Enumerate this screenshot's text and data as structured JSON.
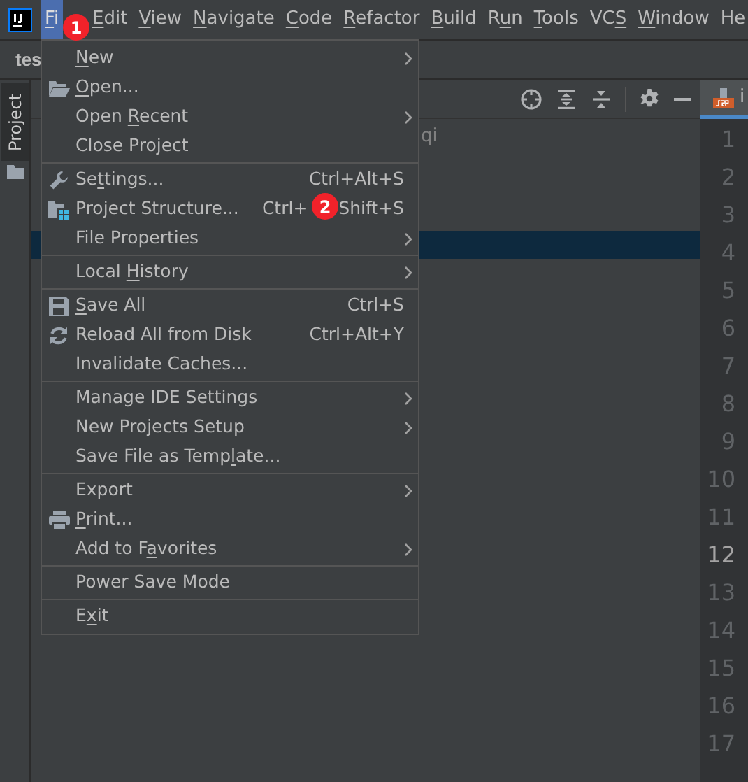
{
  "menu_bar": [
    {
      "mnemonic": "F",
      "label_end": "i",
      "selected": true
    },
    {
      "mnemonic": "E",
      "label_end": "dit",
      "selected": false
    },
    {
      "mnemonic": "V",
      "label_end": "iew",
      "selected": false
    },
    {
      "mnemonic": "N",
      "label_end": "avigate",
      "selected": false
    },
    {
      "mnemonic": "C",
      "label_end": "ode",
      "selected": false
    },
    {
      "mnemonic": "R",
      "label_end": "efactor",
      "selected": false
    },
    {
      "mnemonic": "B",
      "label_end": "uild",
      "selected": false
    },
    {
      "label_start": "R",
      "mnemonic": "u",
      "label_end": "n",
      "selected": false
    },
    {
      "mnemonic": "T",
      "label_end": "ools",
      "selected": false
    },
    {
      "label_start": "VC",
      "mnemonic": "S",
      "selected": false
    },
    {
      "mnemonic": "W",
      "label_end": "indow",
      "selected": false
    },
    {
      "label_start": "He",
      "selected": false
    }
  ],
  "project_title": "tes",
  "tool_window_stripe": {
    "label": "Project",
    "selected": true
  },
  "project_tree": {
    "text_fragment": "qi",
    "selected_row": true
  },
  "editor": {
    "tab_label": "i",
    "line_numbers": [
      {
        "label": "1",
        "current": false
      },
      {
        "label": "2",
        "current": false
      },
      {
        "label": "3",
        "current": false
      },
      {
        "label": "4",
        "current": false
      },
      {
        "label": "5",
        "current": false
      },
      {
        "label": "6",
        "current": false
      },
      {
        "label": "7",
        "current": false
      },
      {
        "label": "8",
        "current": false
      },
      {
        "label": "9",
        "current": false
      },
      {
        "label": "10",
        "current": false
      },
      {
        "label": "11",
        "current": false
      },
      {
        "label": "12",
        "current": true
      },
      {
        "label": "13",
        "current": false
      },
      {
        "label": "14",
        "current": false
      },
      {
        "label": "15",
        "current": false
      },
      {
        "label": "16",
        "current": false
      },
      {
        "label": "17",
        "current": false
      }
    ]
  },
  "file_menu": {
    "groups": [
      {
        "items": [
          {
            "mnemonic": "N",
            "label_end": "ew",
            "submenu": true
          },
          {
            "mnemonic": "O",
            "label_end": "pen...",
            "submenu": false
          },
          {
            "label_start": "Open ",
            "mnemonic": "R",
            "label_end": "ecent",
            "submenu": true
          },
          {
            "label_start": "Close Project",
            "submenu": false
          }
        ]
      },
      {
        "items": [
          {
            "label_start": "Se",
            "mnemonic": "t",
            "label_end": "tings...",
            "shortcut": [
              "Ctrl+Alt+S"
            ],
            "submenu": false
          },
          {
            "label_start": "Project Structure...",
            "shortcut": [
              "Ctrl+",
              "Shift+S"
            ],
            "submenu": false
          },
          {
            "label_start": "File Properties",
            "submenu": true
          }
        ]
      },
      {
        "items": [
          {
            "label_start": "Local ",
            "mnemonic": "H",
            "label_end": "istory",
            "submenu": true
          }
        ]
      },
      {
        "items": [
          {
            "mnemonic": "S",
            "label_end": "ave All",
            "shortcut": [
              "Ctrl+S"
            ],
            "submenu": false
          },
          {
            "label_start": "Reload All from Disk",
            "shortcut": [
              "Ctrl+Alt+Y"
            ],
            "submenu": false
          },
          {
            "label_start": "Invalidate Caches...",
            "submenu": false
          }
        ]
      },
      {
        "items": [
          {
            "label_start": "Manage IDE Settings",
            "submenu": true
          },
          {
            "label_start": "New Projects Setup",
            "submenu": true
          },
          {
            "label_start": "Save File as Temp",
            "mnemonic": "l",
            "label_end": "ate...",
            "submenu": false
          }
        ]
      },
      {
        "items": [
          {
            "label_start": "Export",
            "submenu": true
          },
          {
            "mnemonic": "P",
            "label_end": "rint...",
            "submenu": false
          },
          {
            "label_start": "Add to F",
            "mnemonic": "a",
            "label_end": "vorites",
            "submenu": true
          }
        ]
      },
      {
        "items": [
          {
            "label_start": "Power Save Mode",
            "submenu": false
          }
        ]
      },
      {
        "items": [
          {
            "label_start": "E",
            "mnemonic": "x",
            "label_end": "it",
            "submenu": false
          }
        ]
      }
    ]
  },
  "annotations": [
    {
      "label": "1"
    },
    {
      "label": "2"
    }
  ]
}
